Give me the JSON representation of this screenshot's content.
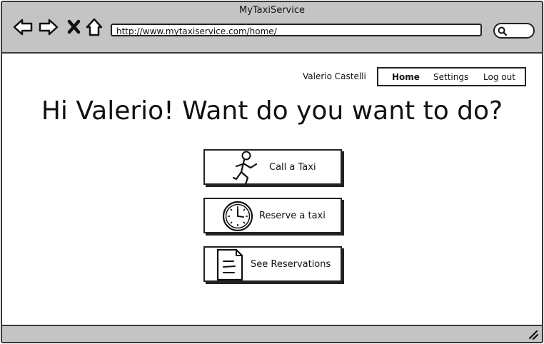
{
  "window": {
    "title": "MyTaxiService"
  },
  "browser": {
    "url": "http://www.mytaxiservice.com/home/",
    "icons": [
      "back-arrow-icon",
      "forward-arrow-icon",
      "close-x-icon",
      "home-icon",
      "search-icon",
      "resize-grip-icon"
    ]
  },
  "header": {
    "user_name": "Valerio Castelli",
    "nav": {
      "home": "Home",
      "settings": "Settings",
      "logout": "Log out"
    }
  },
  "main": {
    "headline": "Hi Valerio! Want do you want to do?",
    "actions": [
      {
        "label": "Call a Taxi",
        "icon": "running-person-icon"
      },
      {
        "label": "Reserve a taxi",
        "icon": "clock-icon"
      },
      {
        "label": "See Reservations",
        "icon": "document-icon"
      }
    ]
  },
  "colors": {
    "chrome": "#c4c4c4",
    "border": "#222222",
    "background": "#ffffff"
  }
}
